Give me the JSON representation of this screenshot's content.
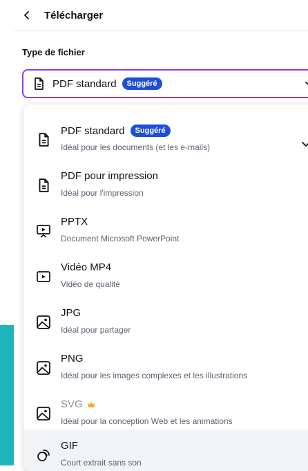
{
  "header": {
    "title": "Télécharger"
  },
  "file_type": {
    "label": "Type de fichier",
    "selected": "PDF standard",
    "selected_badge": "Suggéré"
  },
  "options": [
    {
      "title": "PDF standard",
      "badge": "Suggéré",
      "desc": "Idéal pour les documents (et les e-mails)",
      "icon": "document-icon",
      "selected": true
    },
    {
      "title": "PDF pour impression",
      "desc": "Idéal pour l'impression",
      "icon": "document-icon"
    },
    {
      "title": "PPTX",
      "desc": "Document Microsoft PowerPoint",
      "icon": "presentation-icon"
    },
    {
      "title": "Vidéo MP4",
      "desc": "Vidéo de qualité",
      "icon": "video-icon"
    },
    {
      "title": "JPG",
      "desc": "Idéal pour partager",
      "icon": "image-icon"
    },
    {
      "title": "PNG",
      "desc": "Idéal pour les images complexes et les illustrations",
      "icon": "image-icon"
    },
    {
      "title": "SVG",
      "desc": "Idéal pour la conception Web et les animations",
      "icon": "image-icon",
      "premium": true
    },
    {
      "title": "GIF",
      "desc": "Court extrait sans son",
      "icon": "gif-icon",
      "highlighted": true
    }
  ],
  "colors": {
    "accent": "#8b3dff",
    "badge": "#1d4fd8",
    "crown": "#f5a623"
  }
}
